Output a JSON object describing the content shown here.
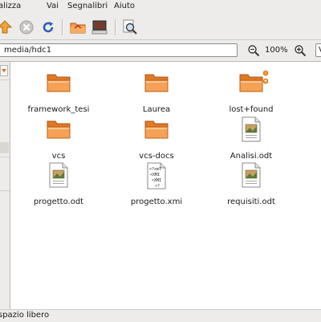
{
  "menubar": {
    "items": [
      {
        "label": "alizza"
      },
      {
        "label": "Vai"
      },
      {
        "label": "Segnalibri"
      },
      {
        "label": "Aiuto"
      }
    ]
  },
  "toolbar": {
    "icons": [
      "up-arrow-icon",
      "stop-icon",
      "reload-icon",
      "home-folder-icon",
      "computer-icon",
      "search-icon"
    ]
  },
  "location": {
    "path": "media/hdc1",
    "zoom": "100%",
    "view_select": "V"
  },
  "files": [
    {
      "name": "framework_tesi",
      "icon": "folder"
    },
    {
      "name": "Laurea",
      "icon": "folder"
    },
    {
      "name": "lost+found",
      "icon": "folder-locked"
    },
    {
      "name": "vcs",
      "icon": "folder"
    },
    {
      "name": "vcs-docs",
      "icon": "folder"
    },
    {
      "name": "Analisi.odt",
      "icon": "document"
    },
    {
      "name": "progetto.odt",
      "icon": "document"
    },
    {
      "name": "progetto.xmi",
      "icon": "xmi-file"
    },
    {
      "name": "requisiti.odt",
      "icon": "document"
    }
  ],
  "xmi_icon_text": [
    "<?xml",
    "<XMI",
    "<XMI",
    "<?"
  ],
  "status": {
    "text": "spazio libero"
  },
  "colors": {
    "folder": "#f08a2e",
    "chrome": "#edeceb",
    "selection": "#d9d7d2"
  }
}
